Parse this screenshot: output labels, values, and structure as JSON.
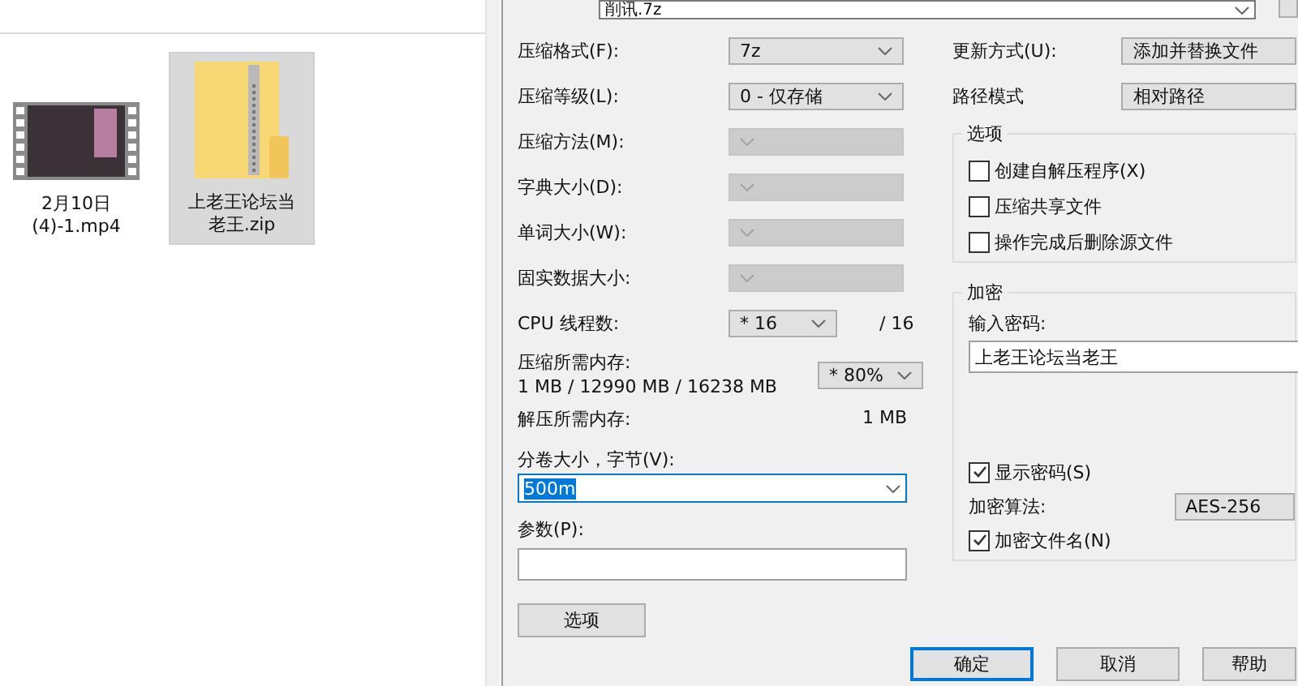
{
  "explorer": {
    "files": [
      {
        "kind": "video",
        "name": "2月10日 (4)-1.mp4",
        "selected": false
      },
      {
        "kind": "archive",
        "name": "上老王论坛当老王.zip",
        "selected": true
      }
    ]
  },
  "dialog": {
    "archive_name": "削讯.7z",
    "settings": [
      {
        "label": "压缩格式(F):",
        "value": "7z",
        "disabled": false
      },
      {
        "label": "压缩等级(L):",
        "value": "0 - 仅存储",
        "disabled": false
      },
      {
        "label": "压缩方法(M):",
        "disabled": true
      },
      {
        "label": "字典大小(D):",
        "disabled": true
      },
      {
        "label": "单词大小(W):",
        "disabled": true
      },
      {
        "label": "固实数据大小:",
        "disabled": true
      }
    ],
    "cpu_threads": {
      "label": "CPU 线程数:",
      "value": "* 16",
      "max": "/ 16"
    },
    "memory": {
      "label": "压缩所需内存:",
      "detail": "1 MB / 12990 MB / 16238 MB",
      "value": "* 80%"
    },
    "decompress_memory": {
      "label": "解压所需内存:",
      "value": "1 MB"
    },
    "volume_size": {
      "label": "分卷大小，字节(V):",
      "value": "500m",
      "text_selected": true
    },
    "parameters": {
      "label": "参数(P):"
    },
    "options_button": "选项",
    "update_mode": {
      "label": "更新方式(U):",
      "value": "添加并替换文件"
    },
    "path_mode": {
      "label": "路径模式",
      "value": "相对路径"
    },
    "options_group": {
      "title": "选项",
      "checkboxes": [
        {
          "label": "创建自解压程序(X)",
          "checked": false
        },
        {
          "label": "压缩共享文件",
          "checked": false
        },
        {
          "label": "操作完成后删除源文件",
          "checked": false
        }
      ]
    },
    "encryption": {
      "title": "加密",
      "password_label": "输入密码:",
      "password": "上老王论坛当老王",
      "show_password": {
        "label": "显示密码(S)",
        "checked": true
      },
      "method_label": "加密算法:",
      "method": "AES-256",
      "encrypt_names": {
        "label": "加密文件名(N)",
        "checked": true
      }
    },
    "buttons": [
      {
        "label": "确定",
        "default": true
      },
      {
        "label": "取消",
        "default": false
      },
      {
        "label": "帮助",
        "default": false
      }
    ]
  }
}
